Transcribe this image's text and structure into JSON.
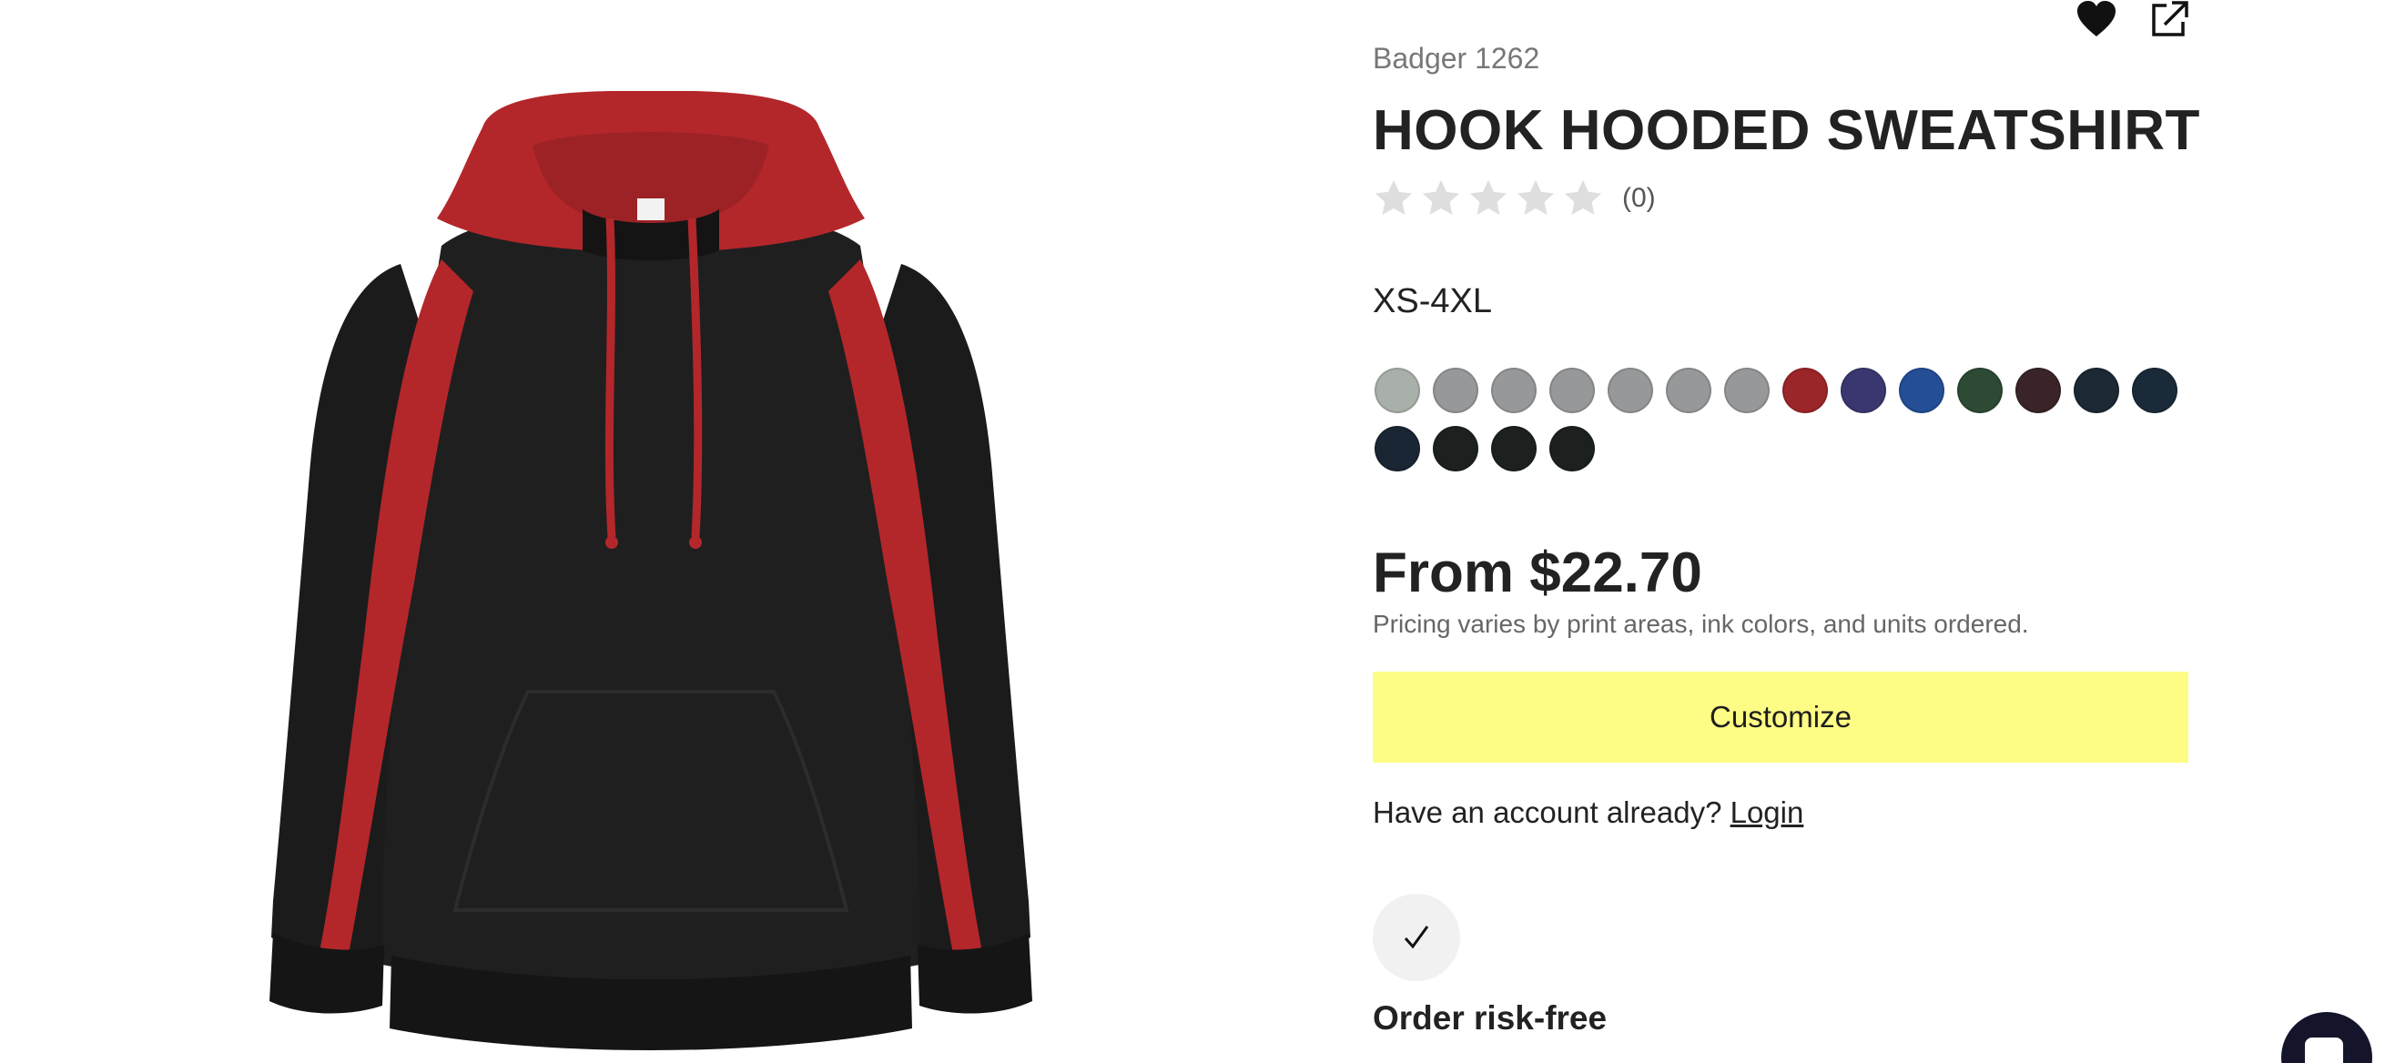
{
  "product": {
    "brand_sku": "Badger 1262",
    "title": "HOOK HOODED SWEATSHIRT",
    "rating_count": "(0)",
    "rating_value": 0,
    "rating_max": 5,
    "size_range": "XS-4XL",
    "swatches": [
      {
        "color": "#a9b0aa"
      },
      {
        "color": "#969899"
      },
      {
        "color": "#969899"
      },
      {
        "color": "#969899"
      },
      {
        "color": "#969899"
      },
      {
        "color": "#969899"
      },
      {
        "color": "#969899"
      },
      {
        "color": "#9a262a"
      },
      {
        "color": "#3a3770"
      },
      {
        "color": "#244e96"
      },
      {
        "color": "#2d4a34"
      },
      {
        "color": "#3a2428"
      },
      {
        "color": "#1c2833"
      },
      {
        "color": "#1a2a38"
      },
      {
        "color": "#1a2633"
      },
      {
        "color": "#1c211f"
      },
      {
        "color": "#1c211f"
      },
      {
        "color": "#1c211f"
      }
    ],
    "price": "From $22.70",
    "price_note": "Pricing varies by print areas, ink colors, and units ordered."
  },
  "actions": {
    "customize_label": "Customize",
    "account_prompt": "Have an account already?",
    "login_label": "Login"
  },
  "assurance": {
    "title": "Order risk-free"
  },
  "icons": {
    "favorite": "heart-icon",
    "share": "external-link-icon",
    "check": "checkmark-icon",
    "chat": "chat-icon"
  },
  "colors": {
    "customize_button": "#fdfd85",
    "hoodie_body": "#1b1b1b",
    "hoodie_accent": "#b3272b",
    "chat_bubble": "#14142b"
  }
}
